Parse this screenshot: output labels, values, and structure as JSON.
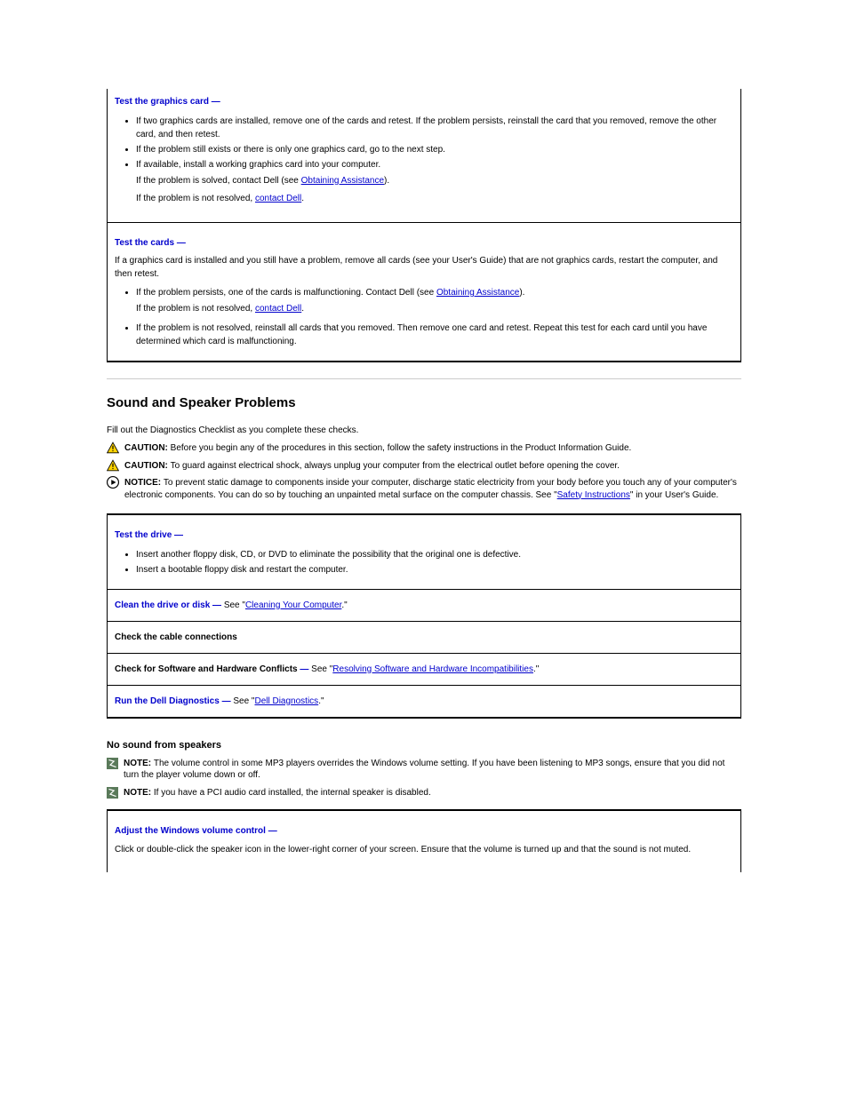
{
  "top_table": {
    "row1": {
      "lead": "Test the graphics card  —",
      "items": [
        "If two graphics cards are installed, remove one of the cards and retest. If the problem persists, reinstall the card that you removed, remove the other card, and then retest.",
        "If the problem still exists or there is only one graphics card, go to the next step.",
        "If available, install a working graphics card into your computer."
      ],
      "trailing_pre": "If the problem is solved, contact Dell (see ",
      "trailing_link": "Obtaining Assistance",
      "trailing_post": ").",
      "resolve_pre": "If the problem is not resolved, ",
      "resolve_link": "contact Dell",
      "resolve_post": "."
    },
    "row2": {
      "lead": "Test the cards  —",
      "sentence": "If a graphics card is installed and you still have a problem, remove all cards (see your User's Guide) that are not graphics cards, restart the computer, and then retest.",
      "list_item_pre1": "If the problem persists, one of the cards is malfunctioning. Contact Dell (see ",
      "list_item_link1": "Obtaining Assistance",
      "list_item_post1": ").",
      "resolve_pre": "If the problem is not resolved, ",
      "resolve_link": "contact Dell",
      "resolve_post": ".",
      "final_item": "If the problem is not resolved, reinstall all cards that you removed. Then remove one card and retest. Repeat this test for each card until you have determined which card is malfunctioning."
    }
  },
  "section": {
    "title": "Sound and Speaker Problems",
    "intro": "Fill out the Diagnostics Checklist as you complete these checks.",
    "caution1_label": "CAUTION: ",
    "caution1_text": "Before you begin any of the procedures in this section, follow the safety instructions in the Product Information Guide.",
    "caution2_label": "CAUTION: ",
    "caution2_text": "To guard against electrical shock, always unplug your computer from the electrical outlet before opening the cover.",
    "notice_label": "NOTICE: ",
    "notice_text_pre": "To prevent static damage to components inside your computer, discharge static electricity from your body before you touch any of your computer's electronic components. You can do so by touching an unpainted metal surface on the computer chassis. See \"",
    "notice_link": "Safety Instructions",
    "notice_text_post": "\" in your User's Guide."
  },
  "drive_table": {
    "row1": {
      "lead": "Test the drive  —",
      "items": [
        "Insert another floppy disk, CD, or DVD to eliminate the possibility that the original one is defective.",
        "Insert a bootable floppy disk and restart the computer."
      ]
    },
    "row2": {
      "lead": "Clean the drive or disk  —",
      "text_pre": " See \"",
      "link": "Cleaning Your Computer",
      "text_post": ".\""
    },
    "row3": {
      "text": "Check the cable connections"
    },
    "row4": {
      "lead_pre": "Check for Software and Hardware Conflicts ",
      "dash": "—",
      "text_pre": " See \"",
      "link": "Resolving Software and Hardware Incompatibilities",
      "text_post": ".\""
    },
    "row5": {
      "lead": "Run the Dell Diagnostics  —",
      "text_pre": " See \"",
      "link": "Dell Diagnostics",
      "text_post": ".\""
    }
  },
  "speakers": {
    "heading": "No sound from speakers",
    "note1_label": "NOTE: ",
    "note1_text": "The volume control in some MP3 players overrides the Windows volume setting. If you have been listening to MP3 songs, ensure that you did not turn the player volume down or off.",
    "note2_label": "NOTE: ",
    "note2_text": "If you have a PCI audio card installed, the internal speaker is disabled."
  },
  "volume_table": {
    "row1": {
      "lead": "Adjust the Windows volume control  —",
      "text": "Click or double-click the speaker icon in the lower-right corner of your screen. Ensure that the volume is turned up and that the sound is not muted."
    }
  }
}
